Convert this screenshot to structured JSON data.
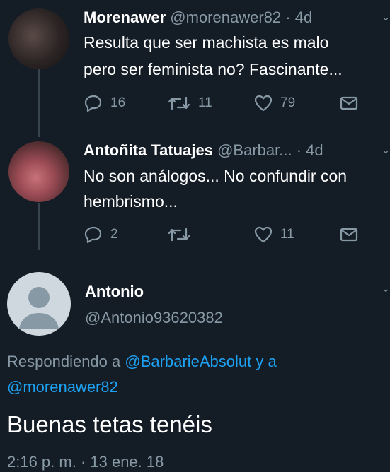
{
  "colors": {
    "background": "#141d26",
    "secondary_text": "#8899a6",
    "link": "#1da1f2",
    "divider": "#38444d"
  },
  "tweets": [
    {
      "name": "Morenawer",
      "handle": "@morenawer82",
      "time": "· 4d",
      "lines": [
        "Resulta que ser machista es malo",
        "pero ser feminista no? Fascinante..."
      ],
      "replies": "16",
      "retweets": "11",
      "likes": "79"
    },
    {
      "name": "Antoñita Tatuajes",
      "handle": "@Barbar...",
      "time": "· 4d",
      "lines": [
        "No son análogos... No confundir con",
        "hembrismo..."
      ],
      "replies": "2",
      "retweets": "",
      "likes": "11"
    }
  ],
  "main": {
    "name": "Antonio",
    "handle": "@Antonio93620382",
    "replying_prefix": "Respondiendo a ",
    "replying_user1": "@BarbarieAbsolut",
    "replying_and": " y a",
    "replying_user2": "@morenawer82",
    "text": "Buenas tetas tenéis",
    "timestamp": "2:16 p. m. · 13 ene. 18"
  },
  "icons": [
    "reply-icon",
    "retweet-icon",
    "like-icon",
    "message-icon",
    "chevron-down-icon",
    "default-avatar-icon"
  ]
}
